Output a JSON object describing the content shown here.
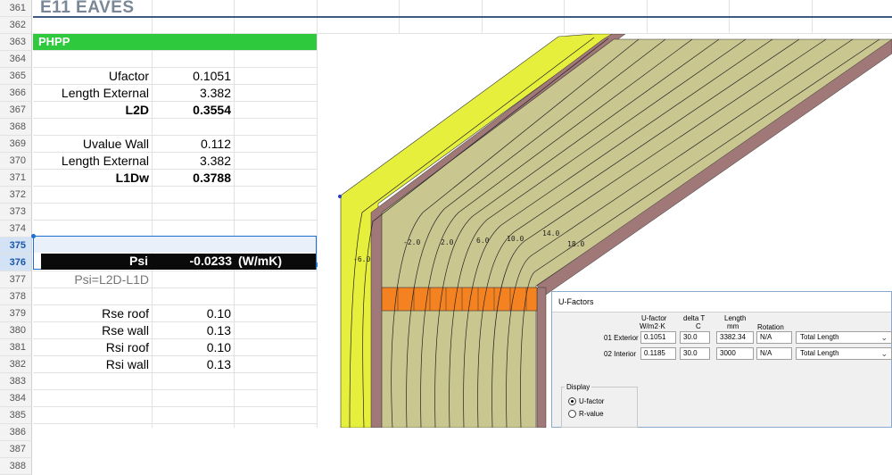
{
  "sheet": {
    "row_numbers": [
      "361",
      "362",
      "363",
      "364",
      "365",
      "366",
      "367",
      "368",
      "369",
      "370",
      "371",
      "372",
      "373",
      "374",
      "375",
      "376",
      "377",
      "378",
      "379",
      "380",
      "381",
      "382",
      "383",
      "384",
      "385",
      "386",
      "387",
      "388"
    ],
    "title": "E11 EAVES",
    "banner": "PHPP",
    "rows": {
      "ufactor": {
        "label": "Ufactor",
        "value": "0.1051"
      },
      "len_ext_1": {
        "label": "Length External",
        "value": "3.382"
      },
      "l2d": {
        "label": "L2D",
        "value": "0.3554"
      },
      "uvalue": {
        "label": "Uvalue Wall",
        "value": "0.112"
      },
      "len_ext_2": {
        "label": "Length External",
        "value": "3.382"
      },
      "l1dw": {
        "label": "L1Dw",
        "value": "0.3788"
      },
      "psi": {
        "label": "Psi",
        "value": "-0.0233",
        "unit": "(W/mK)"
      },
      "psi_formula": "Psi=L2D-L1D",
      "rse_roof": {
        "label": "Rse roof",
        "value": "0.10"
      },
      "rse_wall": {
        "label": "Rse wall",
        "value": "0.13"
      },
      "rsi_roof": {
        "label": "Rsi roof",
        "value": "0.10"
      },
      "rsi_wall": {
        "label": "Rsi wall",
        "value": "0.13"
      }
    }
  },
  "drawing": {
    "isotherm_labels": [
      "-6.0",
      "-2.0",
      "2.0",
      "6.0",
      "10.0",
      "14.0",
      "18.0"
    ]
  },
  "ufactors_dialog": {
    "title": "U-Factors",
    "headers": {
      "ufactor": "U-factor",
      "ufactor_unit": "W/m2·K",
      "delta": "delta T",
      "delta_unit": "C",
      "length": "Length",
      "length_unit": "mm",
      "rotation": "Rotation"
    },
    "rows": [
      {
        "name": "01 Exterior",
        "ufactor": "0.1051",
        "delta": "30.0",
        "length": "3382.34",
        "rotation": "N/A",
        "mode": "Total Length"
      },
      {
        "name": "02 Interior",
        "ufactor": "0.1185",
        "delta": "30.0",
        "length": "3000",
        "rotation": "N/A",
        "mode": "Total Length"
      }
    ],
    "display_label": "Display",
    "option_ufactor": "U-factor",
    "option_rvalue": "R-value"
  },
  "colors": {
    "banner_green": "#2ec93c",
    "title_gray": "#7a8797",
    "selection_blue": "#1f6fd1",
    "insulation": "#c9c690",
    "siding": "#e6f03c",
    "timber": "#f58220",
    "gypsum": "#a07878"
  }
}
